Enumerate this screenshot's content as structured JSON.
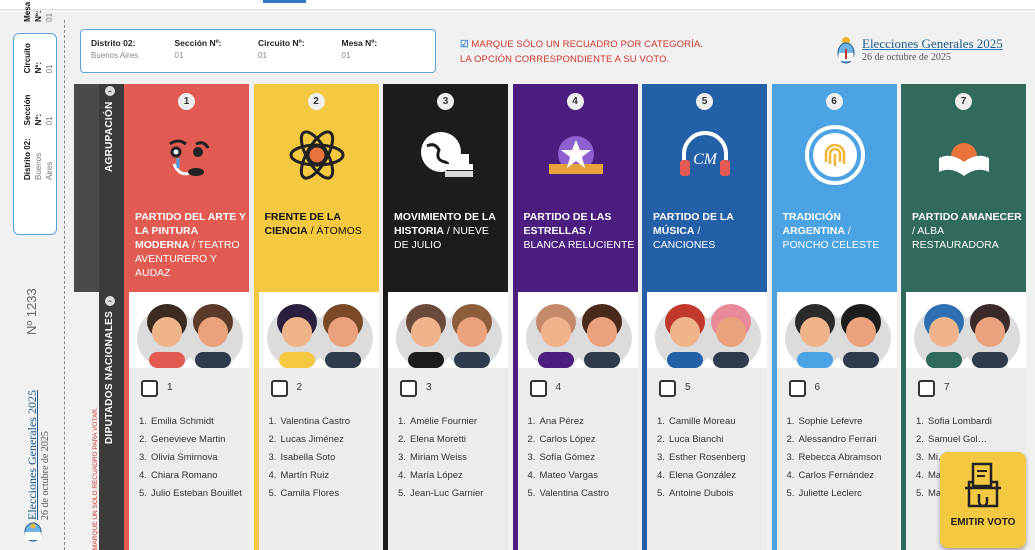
{
  "header": {
    "fields": [
      {
        "label": "Distrito 02:",
        "value": "Buenos Aires"
      },
      {
        "label": "Sección Nº:",
        "value": "01"
      },
      {
        "label": "Circuito Nº:",
        "value": "01"
      },
      {
        "label": "Mesa Nº:",
        "value": "01"
      }
    ],
    "notice_line1": "MARQUE SÓLO UN RECUADRO POR CATEGORÍA.",
    "notice_line2": "LA OPCIÓN CORRESPONDIENTE A SU VOTO.",
    "notice_icon": "☑",
    "brand_title": "Elecciones Generales 2025",
    "brand_date": "26 de octubre de 2025"
  },
  "stub": {
    "distrito_label": "Distrito 02:",
    "distrito_value": "Buenos Aires",
    "seccion_label": "Sección Nº:",
    "seccion_value": "01",
    "circuito_label": "Circuito Nº:",
    "circuito_value": "01",
    "mesa_label": "Mesa Nº:",
    "mesa_value": "01",
    "ballot_number": "Nº 1233",
    "title": "Elecciones Generales 2025",
    "date": "26 de octubre de 2025"
  },
  "rows": {
    "agrupacion": "AGRUPACIÓN",
    "diputados": "DIPUTADOS NACIONALES",
    "instruction": "MARQUE UN SOLO RECUADRO PARA VOTAR."
  },
  "parties": [
    {
      "number": "1",
      "name_bold": "PARTIDO DEL ARTE Y LA PINTURA MODERNA",
      "name_rest": " / TEATRO AVENTURERO Y AUDAZ",
      "color": "#e25b52",
      "logo": "art-face-icon",
      "candidates": [
        "Emilia Schmidt",
        "Genevieve Martin",
        "Olivia Smirnova",
        "Chiara Romano",
        "Julio Esteban Bouillet"
      ]
    },
    {
      "number": "2",
      "name_bold": "FRENTE DE LA CIENCIA",
      "name_rest": " / ÁTOMOS",
      "color": "#f5c842",
      "logo": "atom-icon",
      "candidates": [
        "Valentina Castro",
        "Lucas Jiménez",
        "Isabella Soto",
        "Martín Ruiz",
        "Camila Flores"
      ]
    },
    {
      "number": "3",
      "name_bold": "MOVIMIENTO DE LA HISTORIA",
      "name_rest": " / NUEVE DE JULIO",
      "color": "#1c1c1c",
      "logo": "globe-books-icon",
      "candidates": [
        "Amélie Fournier",
        "Elena Moretti",
        "Miriam Weiss",
        "María López",
        "Jean-Luc Garnier"
      ]
    },
    {
      "number": "4",
      "name_bold": "PARTIDO DE LAS ESTRELLAS",
      "name_rest": " / BLANCA RELUCIENTE",
      "color": "#4a1d7e",
      "logo": "star-icon",
      "candidates": [
        "Ana Pérez",
        "Carlos López",
        "Sofía Gómez",
        "Mateo Vargas",
        "Valentina Castro"
      ]
    },
    {
      "number": "5",
      "name_bold": "PARTIDO DE LA MÚSICA",
      "name_rest": " / CANCIONES",
      "color": "#2460a7",
      "logo": "headphones-icon",
      "candidates": [
        "Camille Moreau",
        "Luca Bianchi",
        "Esther Rosenberg",
        "Elena González",
        "Antoine Dubois"
      ]
    },
    {
      "number": "6",
      "name_bold": "TRADICIÓN ARGENTINA",
      "name_rest": " / PONCHO CELESTE",
      "color": "#4ca3e3",
      "logo": "fingerprint-icon",
      "candidates": [
        "Sophie Lefevre",
        "Alessandro Ferrari",
        "Rebecca Abramson",
        "Carlos Fernández",
        "Juliette Leclerc"
      ]
    },
    {
      "number": "7",
      "name_bold": "PARTIDO AMANECER",
      "name_rest": " / ALBA RESTAURADORA",
      "color": "#2f6a5c",
      "logo": "sunrise-book-icon",
      "candidates": [
        "Sofia Lombardi",
        "Samuel Gol…",
        "Mi… Ro…",
        "Ma…",
        "Ma…"
      ]
    }
  ],
  "emit_button": "EMITIR VOTO"
}
